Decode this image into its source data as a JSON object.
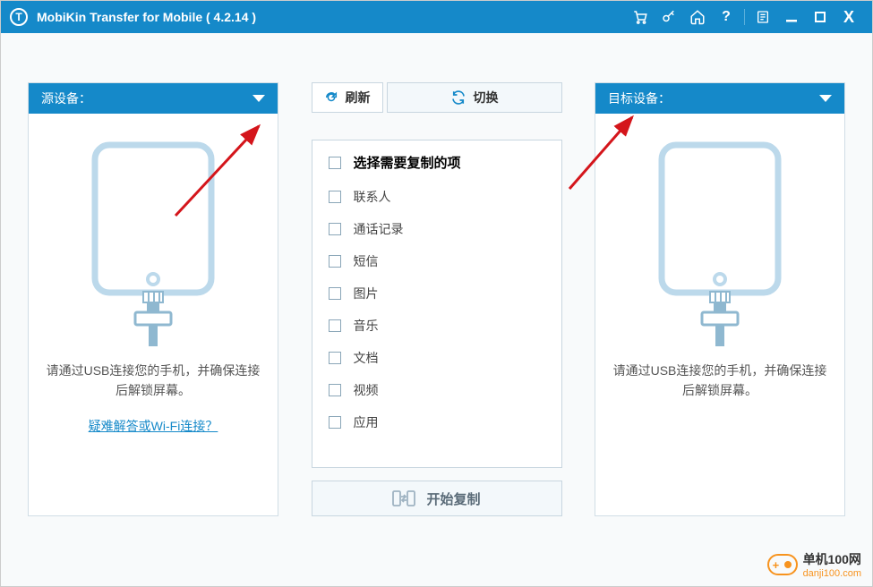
{
  "titlebar": {
    "logo_letter": "T",
    "title": "MobiKin Transfer for Mobile  ( 4.2.14 )"
  },
  "source": {
    "header": "源设备：",
    "instruction": "请通过USB连接您的手机，并确保连接后解锁屏幕。",
    "troubleshoot": "疑难解答或Wi-Fi连接？"
  },
  "target": {
    "header": "目标设备：",
    "instruction": "请通过USB连接您的手机，并确保连接后解锁屏幕。"
  },
  "center": {
    "refresh": "刷新",
    "switch": "切换",
    "checklist_title": "选择需要复制的项",
    "items": [
      "联系人",
      "通话记录",
      "短信",
      "图片",
      "音乐",
      "文档",
      "视频",
      "应用"
    ],
    "start_copy": "开始复制"
  },
  "watermark": {
    "line1": "单机100网",
    "line2": "danji100.com"
  }
}
